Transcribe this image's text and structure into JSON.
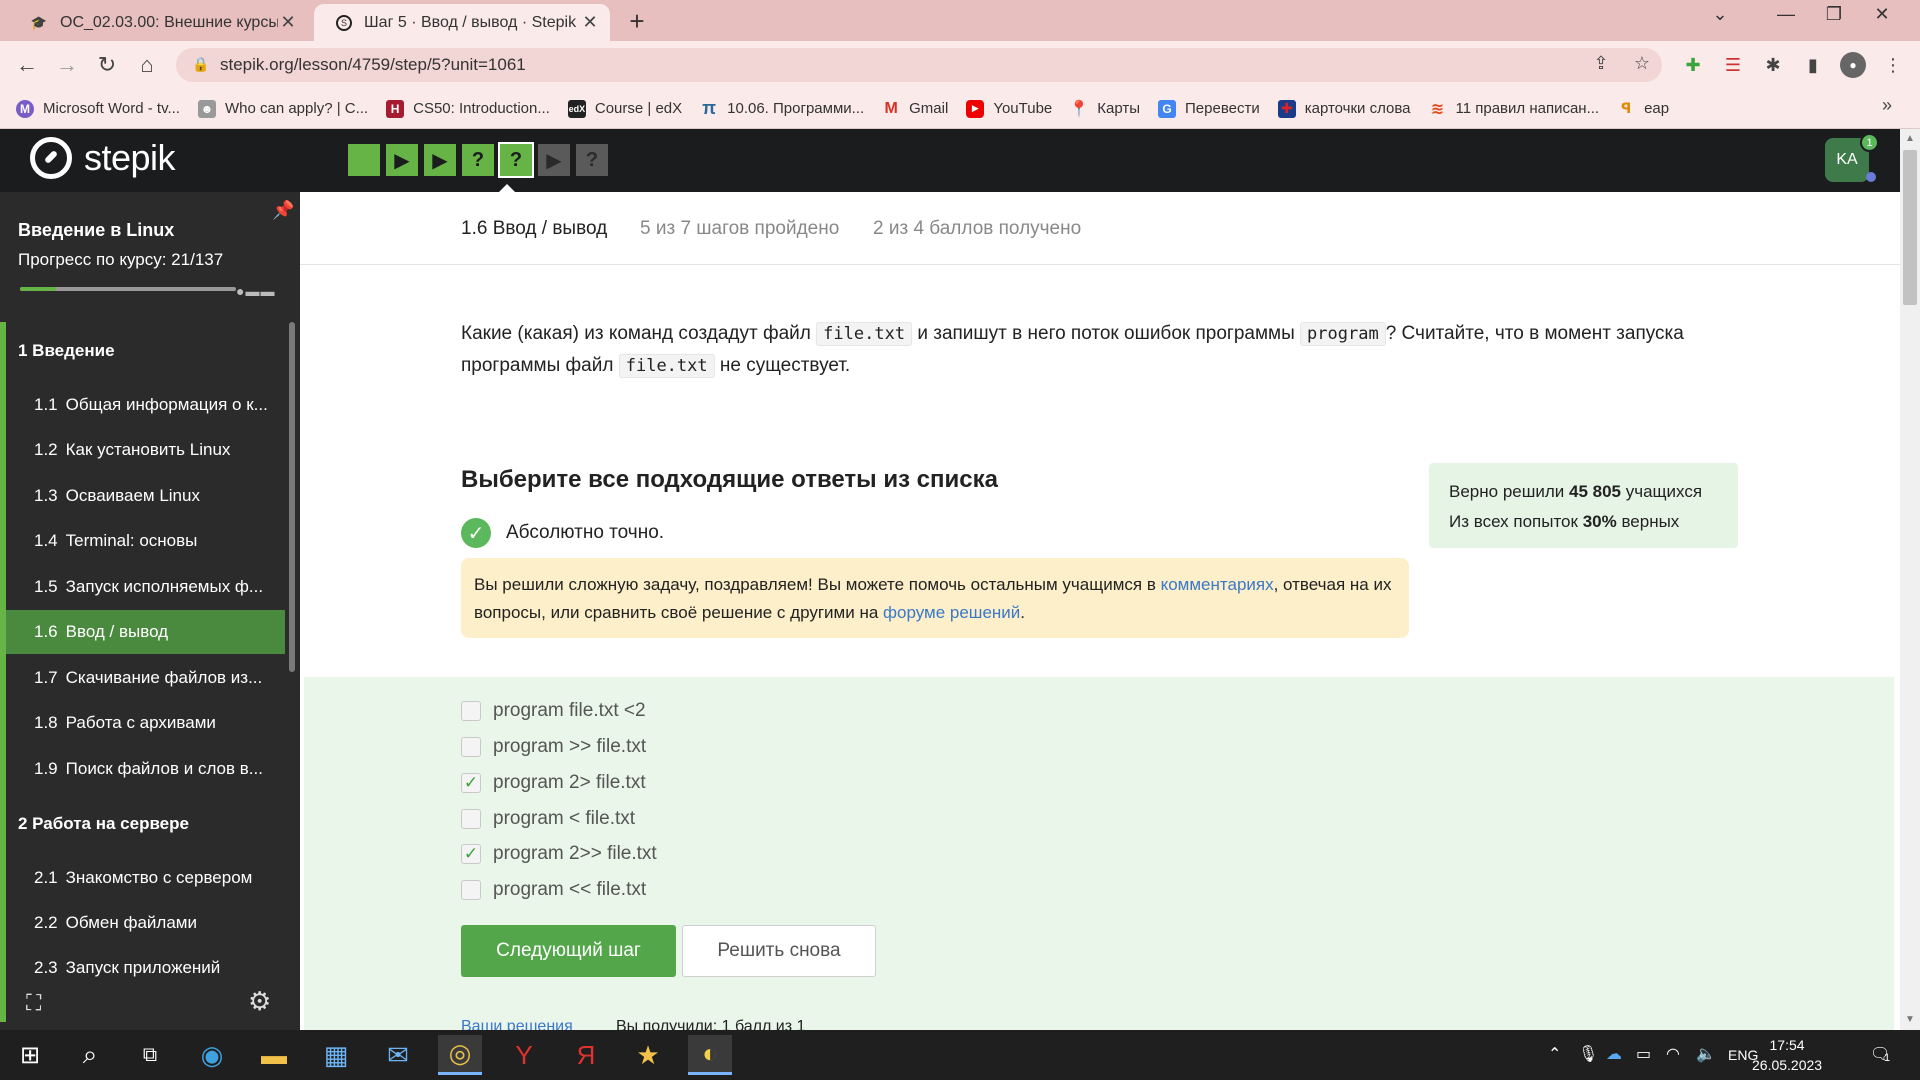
{
  "browser": {
    "tabs": [
      {
        "title": "ОС_02.03.00: Внешние курсы",
        "active": false
      },
      {
        "title": "Шаг 5 · Ввод / вывод · Stepik",
        "active": true
      }
    ],
    "url": "stepik.org/lesson/4759/step/5?unit=1061",
    "bookmarks": [
      "Microsoft Word - tv...",
      "Who can apply? | C...",
      "CS50: Introduction...",
      "Course | edX",
      "10.06. Программи...",
      "Gmail",
      "YouTube",
      "Карты",
      "Перевести",
      "карточки слова",
      "11 правил написан...",
      "eap"
    ]
  },
  "header": {
    "logo_text": "stepik",
    "step_icons": [
      "▶",
      "▶",
      "?",
      "?",
      "▶",
      "?"
    ],
    "avatar_initials": "KA",
    "notification_count": "1"
  },
  "sidebar": {
    "course_title": "Введение в Linux",
    "progress_label": "Прогресс по курсу:  21/137",
    "modules": [
      {
        "label": "1  Введение"
      },
      {
        "label": "2  Работа на сервере"
      }
    ],
    "items": [
      {
        "num": "1.1",
        "label": "Общая информация о к..."
      },
      {
        "num": "1.2",
        "label": "Как установить Linux"
      },
      {
        "num": "1.3",
        "label": "Осваиваем Linux"
      },
      {
        "num": "1.4",
        "label": "Terminal: основы"
      },
      {
        "num": "1.5",
        "label": "Запуск исполняемых ф..."
      },
      {
        "num": "1.6",
        "label": "Ввод / вывод"
      },
      {
        "num": "1.7",
        "label": "Скачивание файлов из..."
      },
      {
        "num": "1.8",
        "label": "Работа с архивами"
      },
      {
        "num": "1.9",
        "label": "Поиск файлов и слов в..."
      },
      {
        "num": "2.1",
        "label": "Знакомство с сервером"
      },
      {
        "num": "2.2",
        "label": "Обмен файлами"
      },
      {
        "num": "2.3",
        "label": "Запуск приложений"
      }
    ]
  },
  "lesson": {
    "crumb": "1.6 Ввод / вывод",
    "steps_done": "5 из 7 шагов пройдено",
    "points": "2 из 4 баллов  получено"
  },
  "question": {
    "p1": "Какие (какая) из команд создадут файл ",
    "code1": "file.txt",
    "p2": " и запишут в него поток ошибок программы ",
    "code2": "program",
    "p3": "? Считайте, что в момент запуска программы файл ",
    "code3": "file.txt",
    "p4": " не существует."
  },
  "quiz": {
    "title": "Выберите все подходящие ответы из списка",
    "status": "Абсолютно точно.",
    "congrats_1": "Вы решили сложную задачу, поздравляем! Вы можете помочь остальным учащимся в ",
    "congrats_link1": "комментариях",
    "congrats_2": ", отвечая на их вопросы, или сравнить своё решение с другими на ",
    "congrats_link2": "форуме решений",
    "congrats_3": ".",
    "options": [
      {
        "label": "program file.txt <2",
        "checked": false
      },
      {
        "label": "program >> file.txt",
        "checked": false
      },
      {
        "label": "program 2> file.txt",
        "checked": true
      },
      {
        "label": "program < file.txt",
        "checked": false
      },
      {
        "label": "program 2>> file.txt",
        "checked": true
      },
      {
        "label": "program << file.txt",
        "checked": false
      }
    ],
    "next_button": "Следующий шаг",
    "retry_button": "Решить снова",
    "solutions_link": "Ваши решения",
    "score_text": "Вы получили: 1 балл из 1"
  },
  "stats": {
    "solved_prefix": "Верно решили ",
    "solved_count": "45 805",
    "solved_suffix": " учащихся",
    "attempts_prefix": "Из всех попыток ",
    "attempts_pct": "30%",
    "attempts_suffix": " верных"
  },
  "taskbar": {
    "lang": "ENG",
    "time": "17:54",
    "date": "26.05.2023",
    "notif_count": "1"
  },
  "colors": {
    "brand_green": "#66b346",
    "header_dark": "#1b1c1e",
    "link_blue": "#3a78c9",
    "congrats_bg": "#fcefc9",
    "answers_bg": "#e9f6e9"
  }
}
